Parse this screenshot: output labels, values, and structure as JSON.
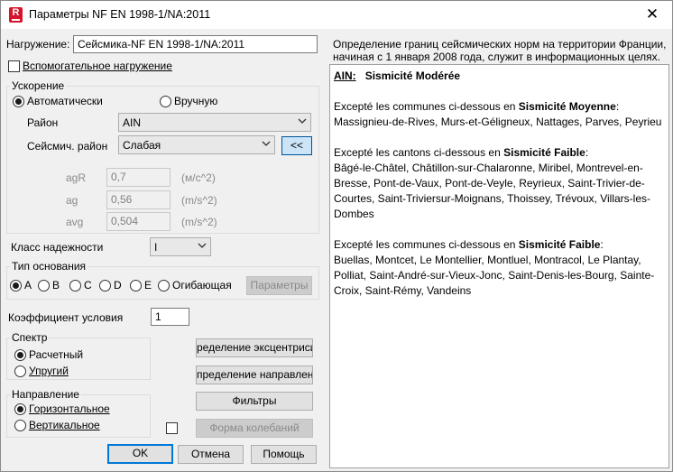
{
  "window": {
    "title": "Параметры NF EN 1998-1/NA:2011",
    "app_icon_letter": "R",
    "close_glyph": "✕"
  },
  "load": {
    "label": "Нагружение:",
    "value": "Сейсмика-NF EN 1998-1/NA:2011",
    "auxiliary_label": "Вспомогательное нагружение"
  },
  "acceleration": {
    "group_title": "Ускорение",
    "auto_label": "Автоматически",
    "manual_label": "Вручную",
    "district_label": "Район",
    "district_value": "AIN",
    "seismic_district_label": "Сейсмич. район",
    "seismic_district_value": "Слабая",
    "collapse_button": "<<",
    "params": [
      {
        "name": "agR",
        "value": "0,7",
        "unit": "(м/с^2)"
      },
      {
        "name": "ag",
        "value": "0,56",
        "unit": "(m/s^2)"
      },
      {
        "name": "avg",
        "value": "0,504",
        "unit": "(m/s^2)"
      }
    ]
  },
  "reliability": {
    "label": "Класс надежности",
    "value": "I"
  },
  "foundation": {
    "group_title": "Тип основания",
    "options": [
      "A",
      "B",
      "C",
      "D",
      "E",
      "Огибающая"
    ],
    "selected_index": 0,
    "params_button": "Параметры"
  },
  "condition": {
    "label": "Коэффициент условия",
    "value": "1"
  },
  "spectrum": {
    "group_title": "Спектр",
    "design_label": "Расчетный",
    "elastic_label": "Упругий"
  },
  "direction": {
    "group_title": "Направление",
    "horizontal_label": "Горизонтальное",
    "vertical_label": "Вертикальное"
  },
  "side_buttons": {
    "eccentricity": "ределение эксцентрисите",
    "directions": "пределение направлени",
    "filters": "Фильтры",
    "mode_shapes": "Форма колебаний"
  },
  "bottom_buttons": {
    "ok": "OK",
    "cancel": "Отмена",
    "help": "Помощь"
  },
  "description": "Определение границ сейсмических норм на территории Франции, начиная с 1 января 2008 года, служит в информационных целях.",
  "info": {
    "heading_code": "AIN:",
    "heading_title": "Sismicité Modérée",
    "sections": [
      {
        "intro": "Excepté les communes ci-dessous en ",
        "category": "Sismicité Moyenne",
        "suffix": ":",
        "list": "Massignieu-de-Rives, Murs-et-Géligneux, Nattages, Parves, Peyrieu"
      },
      {
        "intro": "Excepté les cantons ci-dessous en ",
        "category": "Sismicité Faible",
        "suffix": ":",
        "list": "Bâgé-le-Châtel, Châtillon-sur-Chalaronne, Miribel, Montrevel-en-Bresse, Pont-de-Vaux, Pont-de-Veyle, Reyrieux, Saint-Trivier-de-Courtes, Saint-Triviersur-Moignans, Thoissey, Trévoux, Villars-les-Dombes"
      },
      {
        "intro": "Excepté les communes ci-dessous en ",
        "category": "Sismicité Faible",
        "suffix": ":",
        "list": "Buellas, Montcet, Le Montellier, Montluel, Montracol, Le Plantay, Polliat, Saint-André-sur-Vieux-Jonc, Saint-Denis-les-Bourg, Sainte-Croix, Saint-Rémy, Vandeins"
      }
    ]
  }
}
